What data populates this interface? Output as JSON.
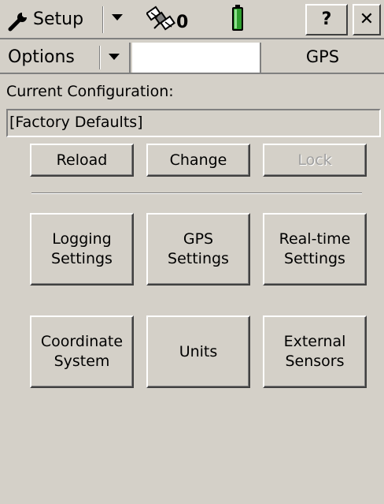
{
  "titlebar": {
    "app_label": "Setup",
    "satellite_count": "0",
    "help_label": "?",
    "close_label": "✕"
  },
  "optionsbar": {
    "options_label": "Options",
    "tab_label": "GPS"
  },
  "config": {
    "current_label": "Current Configuration:",
    "current_value": "[Factory Defaults]"
  },
  "actions": {
    "reload": "Reload",
    "change": "Change",
    "lock": "Lock"
  },
  "settings": {
    "logging": "Logging\nSettings",
    "gps": "GPS\nSettings",
    "realtime": "Real-time\nSettings",
    "coordinate": "Coordinate\nSystem",
    "units": "Units",
    "external": "External\nSensors"
  },
  "colors": {
    "background": "#d4d0c8",
    "battery": "#2e9e2e",
    "disabled_text": "#a0a0a0"
  },
  "icons": {
    "setup": "wrench-icon",
    "satellite": "satellite-icon",
    "battery": "battery-icon"
  }
}
